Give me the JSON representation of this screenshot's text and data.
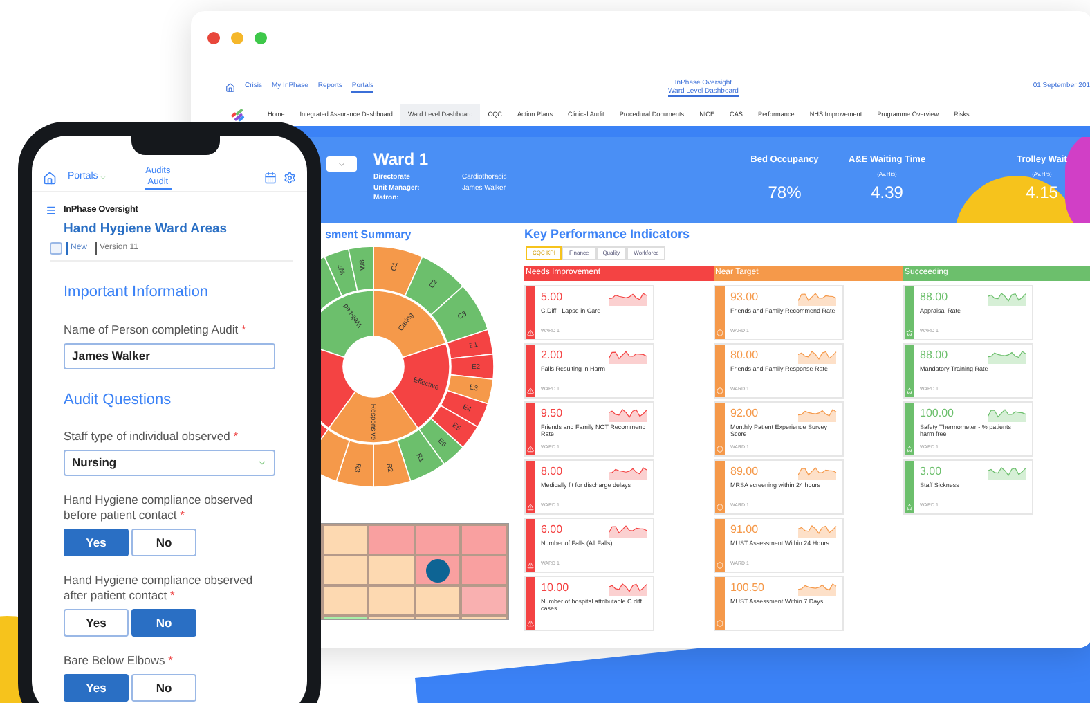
{
  "browser": {
    "top_links": [
      {
        "label": "Crisis",
        "selected": false
      },
      {
        "label": "My InPhase",
        "selected": false
      },
      {
        "label": "Reports",
        "selected": false
      },
      {
        "label": "Portals",
        "selected": true
      }
    ],
    "app_title": "InPhase Oversight",
    "app_subtitle": "Ward Level Dashboard",
    "date": "01 September 201",
    "nav_tabs": [
      {
        "label": "Home",
        "selected": false
      },
      {
        "label": "Integrated Assurance Dashboard",
        "selected": false
      },
      {
        "label": "Ward Level Dashboard",
        "selected": true
      },
      {
        "label": "CQC",
        "selected": false
      },
      {
        "label": "Action Plans",
        "selected": false
      },
      {
        "label": "Clinical Audit",
        "selected": false
      },
      {
        "label": "Procedural Documents",
        "selected": false
      },
      {
        "label": "NICE",
        "selected": false
      },
      {
        "label": "CAS",
        "selected": false
      },
      {
        "label": "Performance",
        "selected": false
      },
      {
        "label": "NHS Improvement",
        "selected": false
      },
      {
        "label": "Programme Overview",
        "selected": false
      },
      {
        "label": "Risks",
        "selected": false
      }
    ],
    "ward": {
      "name": "Ward 1",
      "details": [
        {
          "label": "Directorate",
          "value": "Cardiothoracic"
        },
        {
          "label": "Unit Manager:",
          "value": "James Walker"
        },
        {
          "label": "Matron:"
        }
      ]
    },
    "metrics": [
      {
        "label": "Bed Occupancy",
        "value": "78%"
      },
      {
        "label": "A&E Waiting Time",
        "unit": "(Av.Hrs)",
        "value": "4.39"
      },
      {
        "label": "Trolley Wait",
        "unit": "(Av.Hrs)",
        "value": "4.15"
      }
    ],
    "assessment": {
      "title": "sment Summary",
      "sunburst": [
        {
          "label": "Caring",
          "color": "#f5994a",
          "children": [
            {
              "label": "C1",
              "color": "#f5994a"
            },
            {
              "label": "C2",
              "color": "#6cbf6c"
            },
            {
              "label": "C3",
              "color": "#6cbf6c"
            }
          ]
        },
        {
          "label": "Effective",
          "color": "#f44343",
          "children": [
            {
              "label": "E1",
              "color": "#f44343"
            },
            {
              "label": "E2",
              "color": "#f44343"
            },
            {
              "label": "E3",
              "color": "#f5994a"
            },
            {
              "label": "E4",
              "color": "#f44343"
            },
            {
              "label": "E5",
              "color": "#f44343"
            },
            {
              "label": "E6",
              "color": "#6cbf6c"
            }
          ]
        },
        {
          "label": "Responsive",
          "color": "#f5994a",
          "children": [
            {
              "label": "R1",
              "color": "#6cbf6c"
            },
            {
              "label": "R2",
              "color": "#f5994a"
            },
            {
              "label": "R3",
              "color": "#f5994a"
            },
            {
              "color": "#f5994a"
            }
          ]
        },
        {
          "color": "#f44343"
        },
        {
          "label": "Well-Led",
          "color": "#6cbf6c",
          "children": [
            {
              "label": "W7",
              "color": "#6cbf6c"
            },
            {
              "label": "W8",
              "color": "#6cbf6c"
            }
          ]
        }
      ]
    },
    "kpi": {
      "title": "Key Performance Indicators",
      "tabs": [
        {
          "label": "CQC KPI",
          "selected": true
        },
        {
          "label": "Finance",
          "selected": false
        },
        {
          "label": "Quality",
          "selected": false
        },
        {
          "label": "Workforce",
          "selected": false
        }
      ],
      "groups": [
        {
          "kind": "needs",
          "title": "Needs Improvement",
          "cards": [
            {
              "value": "5.00",
              "name": "C.Diff - Lapse in Care",
              "ward": "WARD 1"
            },
            {
              "value": "2.00",
              "name": "Falls Resulting in Harm",
              "ward": "WARD 1"
            },
            {
              "value": "9.50",
              "name": "Friends and Family NOT Recommend Rate",
              "ward": "WARD 1"
            },
            {
              "value": "8.00",
              "name": "Medically fit for discharge delays",
              "ward": "WARD 1"
            },
            {
              "value": "6.00",
              "name": "Number of Falls (All Falls)",
              "ward": "WARD 1"
            },
            {
              "value": "10.00",
              "name": "Number of hospital attributable C.diff cases"
            }
          ]
        },
        {
          "kind": "near",
          "title": "Near Target",
          "cards": [
            {
              "value": "93.00",
              "name": "Friends and Family Recommend Rate",
              "ward": "WARD 1"
            },
            {
              "value": "80.00",
              "name": "Friends and Family Response Rate",
              "ward": "WARD 1"
            },
            {
              "value": "92.00",
              "name": "Monthly Patient Experience Survey Score",
              "ward": "WARD 1"
            },
            {
              "value": "89.00",
              "name": "MRSA screening within 24 hours",
              "ward": "WARD 1"
            },
            {
              "value": "91.00",
              "name": "MUST Assessment Within 24 Hours",
              "ward": "WARD 1"
            },
            {
              "value": "100.50",
              "name": "MUST Assessment Within 7 Days"
            }
          ]
        },
        {
          "kind": "succeeding",
          "title": "Succeeding",
          "cards": [
            {
              "value": "88.00",
              "name": "Appraisal Rate",
              "ward": "WARD 1"
            },
            {
              "value": "88.00",
              "name": "Mandatory Training Rate",
              "ward": "WARD 1"
            },
            {
              "value": "100.00",
              "name": "Safety Thermometer - % patients harm free",
              "ward": "WARD 1"
            },
            {
              "value": "3.00",
              "name": "Staff Sickness",
              "ward": "WARD 1"
            }
          ]
        }
      ]
    }
  },
  "phone": {
    "portals": "Portals",
    "section": "Audits",
    "page": "Audit",
    "brand": "InPhase Oversight",
    "form_title": "Hand Hygiene Ward Areas",
    "status": {
      "checked": false,
      "label": "New",
      "version": "Version 11"
    },
    "sections": [
      {
        "title": "Important Information",
        "fields": [
          {
            "kind": "text",
            "label": "Name of Person completing Audit",
            "required": "*",
            "value": "James Walker"
          }
        ]
      },
      {
        "title": "Audit Questions",
        "fields": [
          {
            "kind": "select",
            "label": "Staff type of individual observed",
            "required": "*",
            "value": "Nursing"
          },
          {
            "kind": "choice",
            "label": "Hand Hygiene compliance observed before patient contact",
            "required": "*",
            "options": [
              {
                "label": "Yes",
                "selected": true
              },
              {
                "label": "No",
                "selected": false
              }
            ]
          },
          {
            "kind": "choice",
            "label": "Hand Hygiene compliance observed after patient contact",
            "required": "*",
            "options": [
              {
                "label": "Yes",
                "selected": false
              },
              {
                "label": "No",
                "selected": true
              }
            ]
          },
          {
            "kind": "choice",
            "label": "Bare Below Elbows",
            "required": "*",
            "options": [
              {
                "label": "Yes",
                "selected": true
              },
              {
                "label": "No",
                "selected": false
              }
            ]
          }
        ]
      }
    ]
  }
}
